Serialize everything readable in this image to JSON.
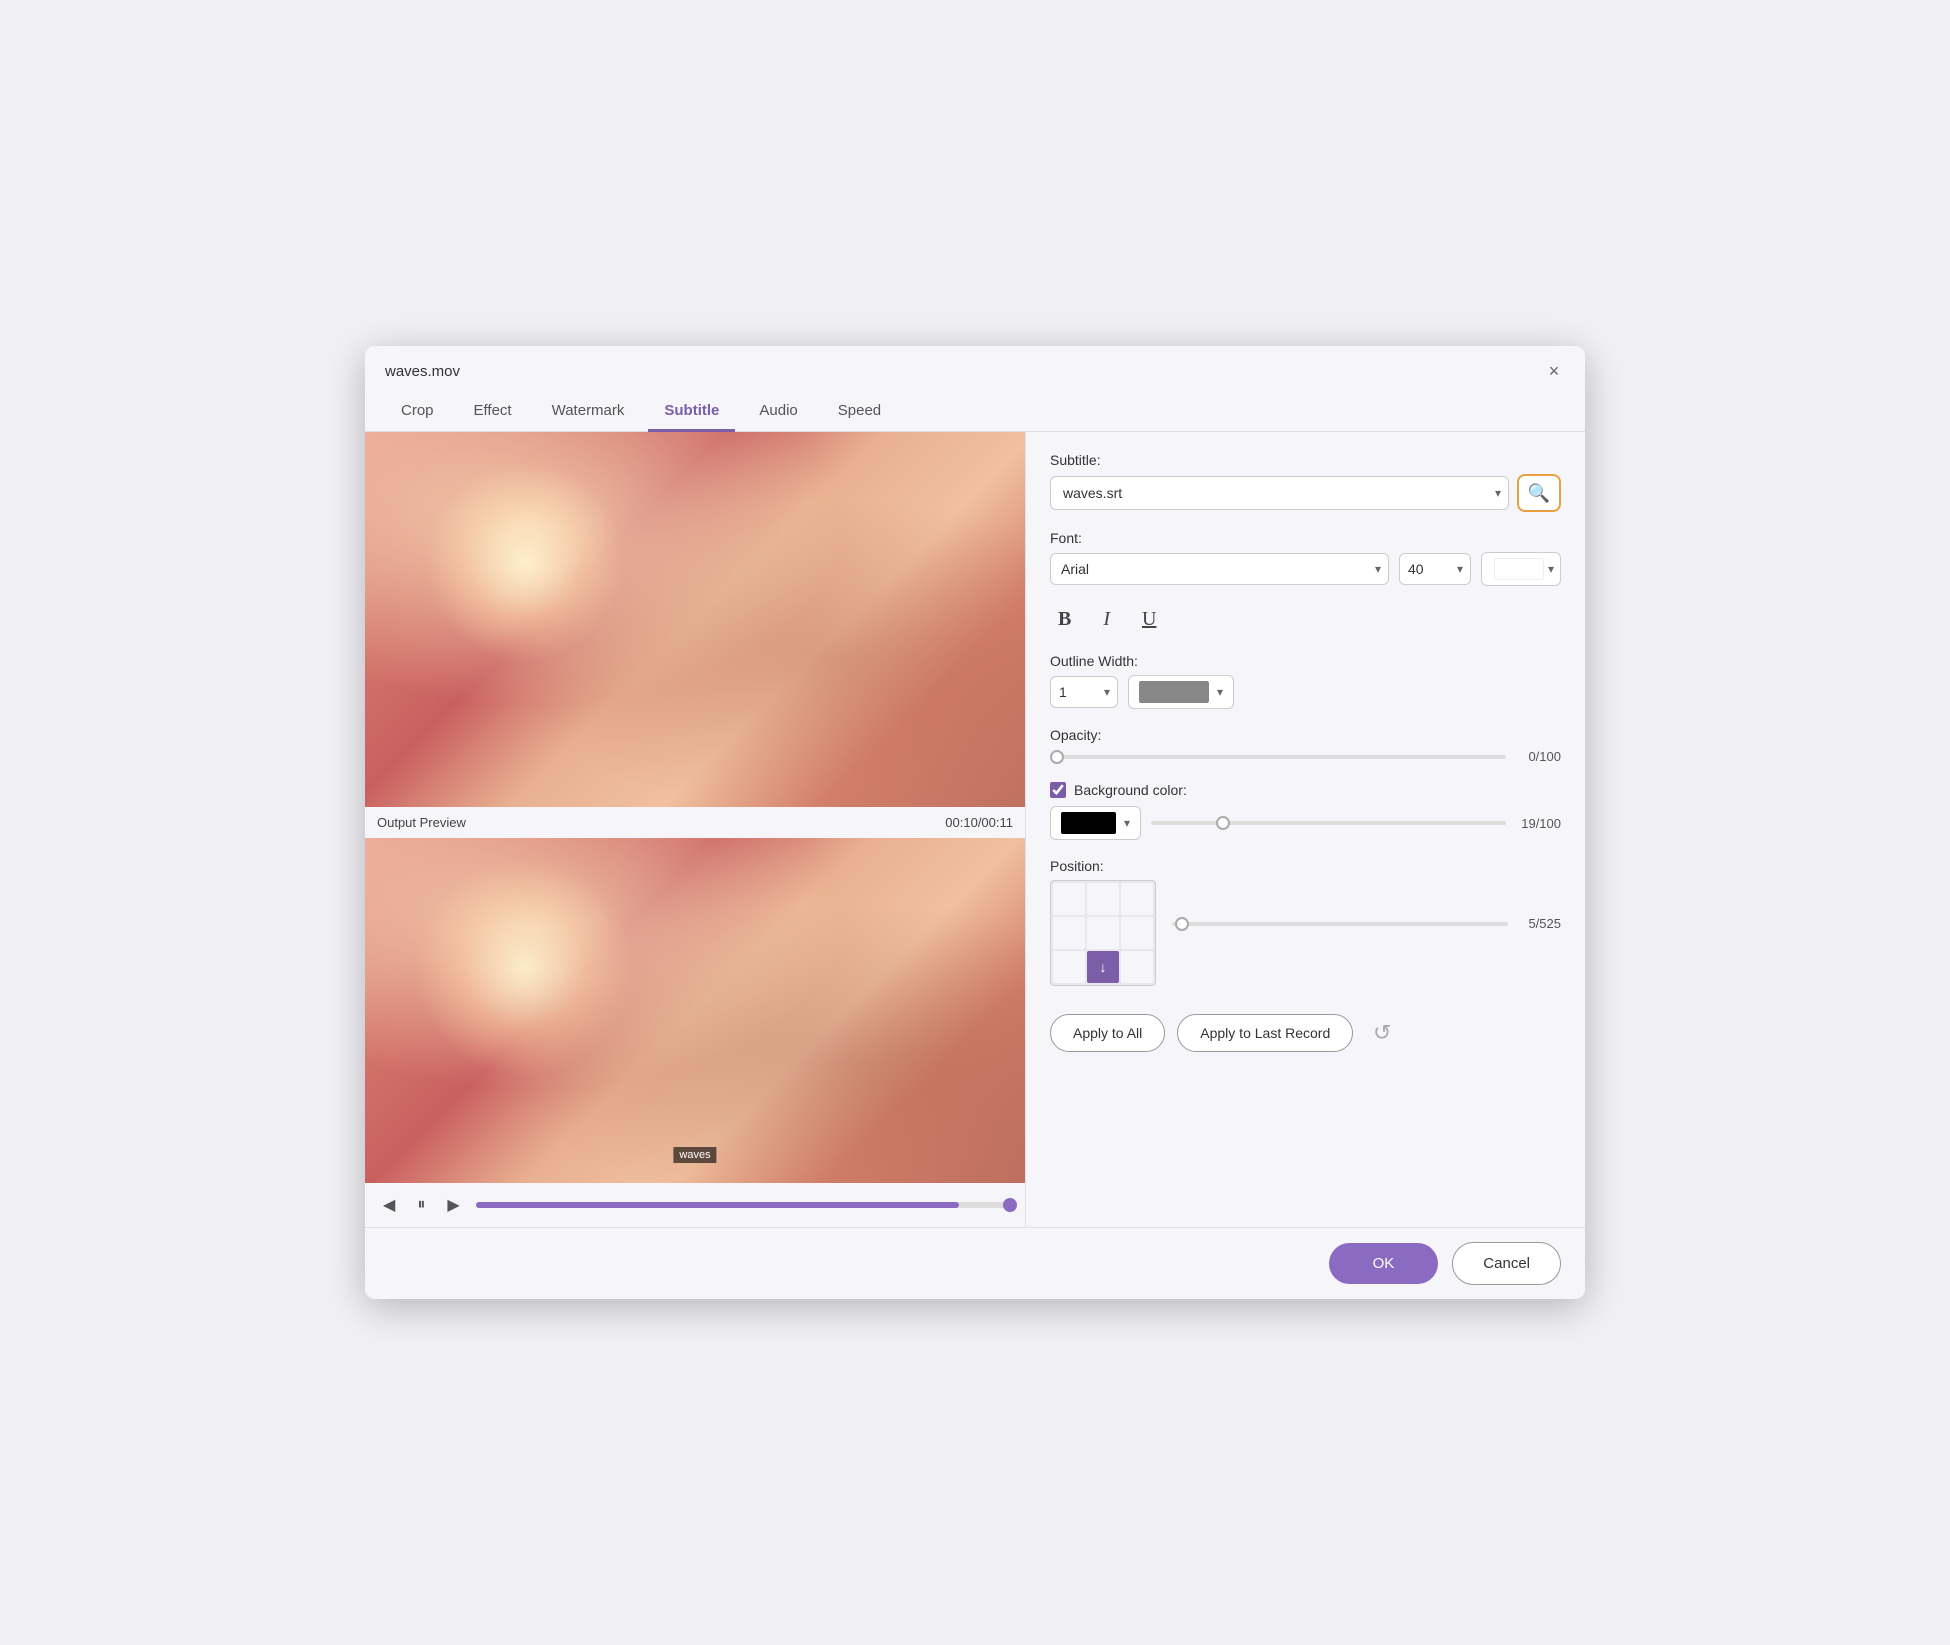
{
  "dialog": {
    "title": "waves.mov",
    "close_label": "×"
  },
  "tabs": [
    {
      "id": "crop",
      "label": "Crop",
      "active": false
    },
    {
      "id": "effect",
      "label": "Effect",
      "active": false
    },
    {
      "id": "watermark",
      "label": "Watermark",
      "active": false
    },
    {
      "id": "subtitle",
      "label": "Subtitle",
      "active": true
    },
    {
      "id": "audio",
      "label": "Audio",
      "active": false
    },
    {
      "id": "speed",
      "label": "Speed",
      "active": false
    }
  ],
  "preview": {
    "output_label": "Output Preview",
    "timestamp": "00:10/00:11",
    "watermark_text": "waves"
  },
  "controls": {
    "prev": "◀",
    "pause": "⏸",
    "next": "▶"
  },
  "subtitle_section": {
    "label": "Subtitle:",
    "value": "waves.srt",
    "search_icon": "🔍"
  },
  "font_section": {
    "label": "Font:",
    "font_value": "Arial",
    "size_value": "40",
    "color_swatch": "white"
  },
  "format": {
    "bold": "B",
    "italic": "I",
    "underline": "U"
  },
  "outline": {
    "label": "Outline Width:",
    "width_value": "1",
    "color": "#888888"
  },
  "opacity": {
    "label": "Opacity:",
    "value": "0",
    "max": "100",
    "display": "0/100"
  },
  "background": {
    "label": "Background color:",
    "checked": true,
    "color": "#000000",
    "opacity_value": "19",
    "opacity_max": "100",
    "opacity_display": "19/100"
  },
  "position": {
    "label": "Position:",
    "slider_value": "5",
    "slider_max": "525",
    "slider_display": "5/525",
    "active_cell": 7,
    "arrow": "↓"
  },
  "action_buttons": {
    "apply_all": "Apply to All",
    "apply_last": "Apply to Last Record",
    "refresh_icon": "↺"
  },
  "bottom_buttons": {
    "ok": "OK",
    "cancel": "Cancel"
  }
}
